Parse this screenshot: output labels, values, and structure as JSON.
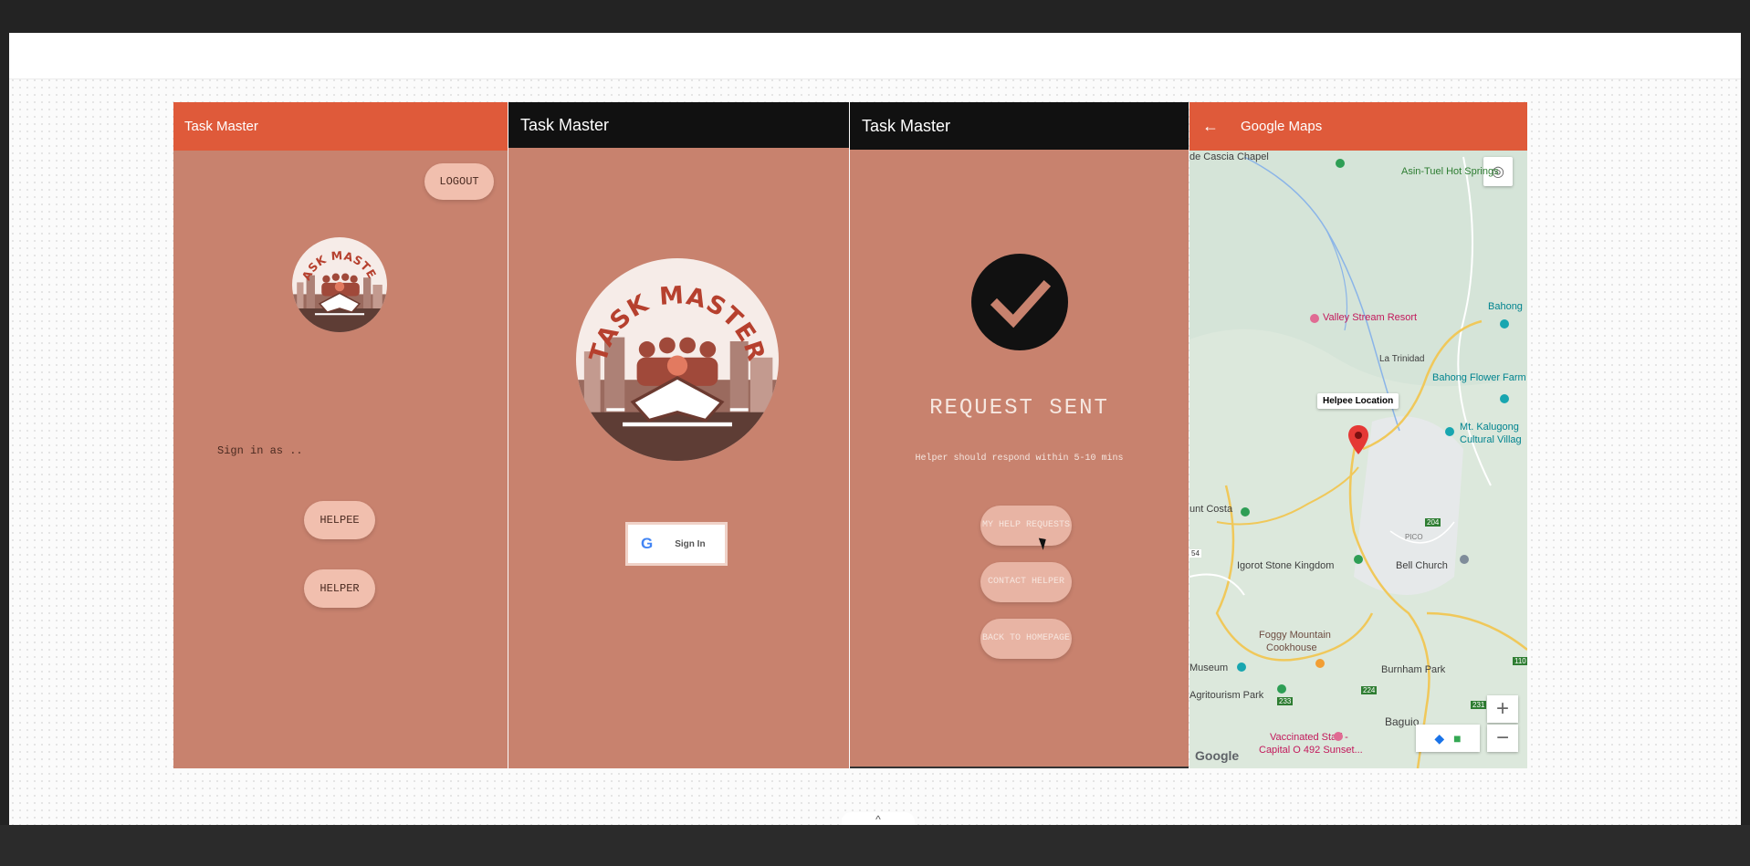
{
  "screens": {
    "login": {
      "app_title": "Task Master",
      "logout_label": "LOGOUT",
      "signin_prompt": "Sign in as ..",
      "helpee_label": "HELPEE",
      "helper_label": "HELPER"
    },
    "google": {
      "app_title": "Task Master",
      "signin_label": "Sign In"
    },
    "request": {
      "app_title": "Task Master",
      "heading": "REQUEST SENT",
      "subtext": "Helper should respond within 5-10 mins",
      "my_help_requests_label": "MY HELP REQUESTS",
      "contact_helper_label": "CONTACT HELPER",
      "back_to_homepage_label": "BACK TO HOMEPAGE"
    },
    "maps": {
      "app_title": "Google Maps",
      "pin_label": "Helpee Location",
      "places": {
        "chapel": "de Cascia Chapel",
        "hot_springs": "Asin-Tuel Hot Springs",
        "valley_resort": "Valley Stream Resort",
        "bahong": "Bahong",
        "la_trinidad": "La Trinidad",
        "flower_farm": "Bahong Flower Farm",
        "kalugong": "Mt. Kalugong",
        "kalugong2": "Cultural Villag",
        "costa": "unt Costa",
        "igorot": "Igorot Stone Kingdom",
        "bell_church": "Bell Church",
        "foggy": "Foggy Mountain",
        "cookhouse": "Cookhouse",
        "museum": "Museum",
        "agritourism": "Agritourism Park",
        "burnham": "Burnham Park",
        "baguio": "Baguio",
        "vaccinated": "Vaccinated Staff -",
        "capital": "Capital O 492 Sunset...",
        "pico": "PICO",
        "road_204": "204",
        "road_54": "54",
        "road_233": "233",
        "road_224": "224",
        "road_231": "231",
        "road_110": "110"
      },
      "zoom_in": "+",
      "zoom_out": "−",
      "google_logo": "Google"
    },
    "logo_text": "TASK MASTER"
  },
  "colors": {
    "screen_bg": "#c8826e",
    "appbar_orange": "#df5a3a",
    "appbar_dark": "#111111",
    "pill": "#f1bfae"
  },
  "collapse_icon": "^"
}
